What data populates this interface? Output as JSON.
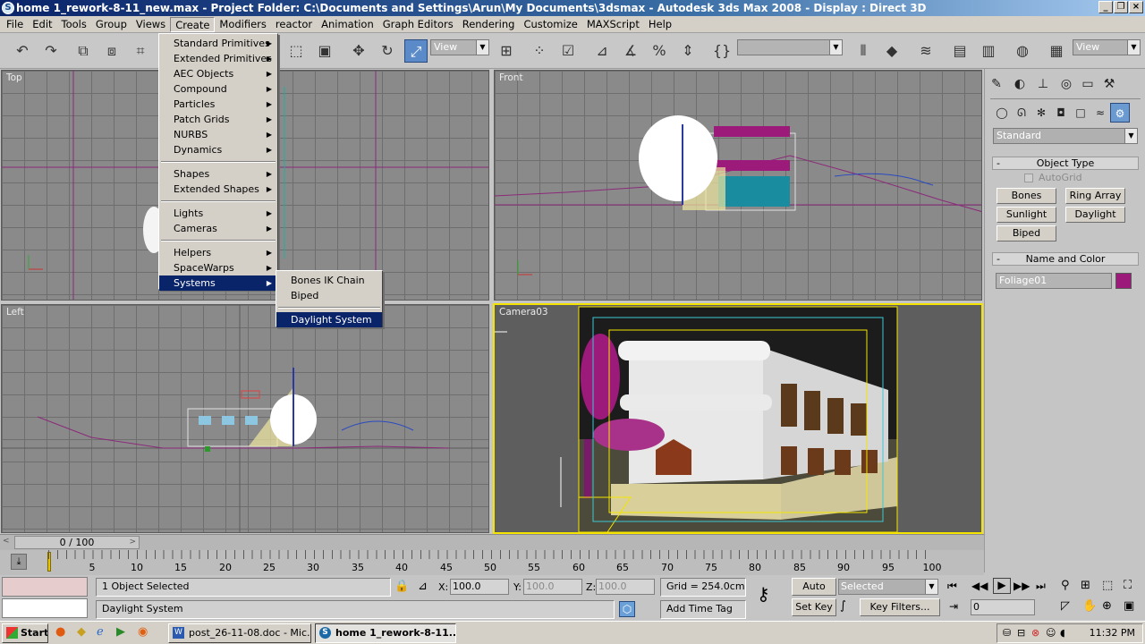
{
  "window": {
    "title": "home 1_rework-8-11_new.max    - Project Folder: C:\\Documents and Settings\\Arun\\My Documents\\3dsmax    - Autodesk 3ds Max 2008     - Display : Direct 3D"
  },
  "menubar": [
    "File",
    "Edit",
    "Tools",
    "Group",
    "Views",
    "Create",
    "Modifiers",
    "reactor",
    "Animation",
    "Graph Editors",
    "Rendering",
    "Customize",
    "MAXScript",
    "Help"
  ],
  "toolbar": {
    "view_combo_left": "View",
    "view_combo_right": "View",
    "named_selection": ""
  },
  "create_menu": {
    "items": [
      "Standard Primitives",
      "Extended Primitives",
      "AEC Objects",
      "Compound",
      "Particles",
      "Patch Grids",
      "NURBS",
      "Dynamics",
      "Shapes",
      "Extended Shapes",
      "Lights",
      "Cameras",
      "Helpers",
      "SpaceWarps",
      "Systems"
    ],
    "highlighted": "Systems"
  },
  "systems_submenu": {
    "items": [
      "Bones IK Chain",
      "Biped",
      "Daylight System"
    ],
    "highlighted": "Daylight System"
  },
  "viewports": {
    "top": "Top",
    "front": "Front",
    "left": "Left",
    "camera": "Camera03"
  },
  "command_panel": {
    "category": "Standard",
    "object_type_title": "Object Type",
    "autogrid": "AutoGrid",
    "buttons": [
      "Bones",
      "Ring Array",
      "Sunlight",
      "Daylight",
      "Biped"
    ],
    "name_color_title": "Name and Color",
    "object_name": "Foliage01",
    "object_color": "#9b1a7a"
  },
  "timeline": {
    "position": "0 / 100",
    "ticks": [
      "5",
      "10",
      "15",
      "20",
      "25",
      "30",
      "35",
      "40",
      "45",
      "50",
      "55",
      "60",
      "65",
      "70",
      "75",
      "80",
      "85",
      "90",
      "95",
      "100"
    ]
  },
  "status": {
    "selection": "1 Object Selected",
    "prompt": "Daylight System",
    "x_label": "X:",
    "x": "100.0",
    "y_label": "Y:",
    "y": "100.0",
    "z_label": "Z:",
    "z": "100.0",
    "grid": "Grid = 254.0cm",
    "add_time_tag": "Add Time Tag",
    "auto_key": "Auto Key",
    "set_key": "Set Key",
    "selected": "Selected",
    "key_filters": "Key Filters...",
    "frame": "0"
  },
  "taskbar": {
    "start": "Start",
    "tasks": [
      "post_26-11-08.doc - Mic...",
      "home 1_rework-8-11..."
    ],
    "clock": "11:32 PM"
  }
}
